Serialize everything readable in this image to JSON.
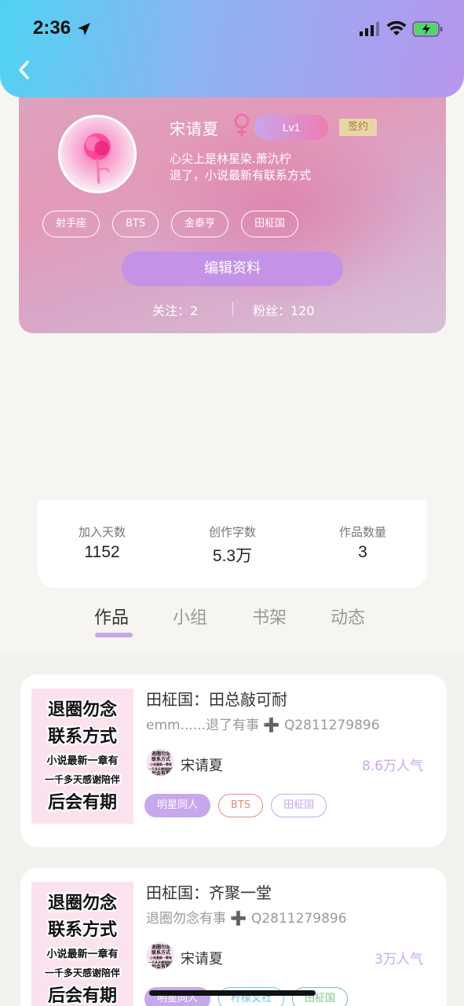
{
  "status_bar": {
    "time": "2:36"
  },
  "profile": {
    "username": "宋请夏",
    "level": "Lv1",
    "sign_badge": "签约",
    "bio_line1": "心尖上是林星染.萧氿柠",
    "bio_line2": "退了，小说最新有联系方式",
    "tags": [
      "射手座",
      "BTS",
      "金泰亨",
      "田柾国"
    ],
    "edit_button": "编辑资料",
    "following": "关注：2",
    "fans": "粉丝：120"
  },
  "stats": [
    {
      "label": "加入天数",
      "value": "1152"
    },
    {
      "label": "创作字数",
      "value": "5.3万"
    },
    {
      "label": "作品数量",
      "value": "3"
    }
  ],
  "tabs": [
    "作品",
    "小组",
    "书架",
    "动态"
  ],
  "works": [
    {
      "title": "田柾国：田总敲可耐",
      "desc": "emm......退了有事 ➕ Q2811279896",
      "author": "宋请夏",
      "popularity": "8.6万人气",
      "tags": [
        {
          "label": "明星同人",
          "color": "#c7a8ec",
          "filled": true
        },
        {
          "label": "BTS",
          "color": "#e58c86",
          "filled": false
        },
        {
          "label": "田柾国",
          "color": "#c7a8ec",
          "filled": false
        }
      ]
    },
    {
      "title": "田柾国：齐聚一堂",
      "desc": "退圈勿念有事 ➕ Q2811279896",
      "author": "宋请夏",
      "popularity": "3万人气",
      "tags": [
        {
          "label": "明星同人",
          "color": "#c7a8ec",
          "filled": true
        },
        {
          "label": "柠檬文社",
          "color": "#6cc7d9",
          "filled": false
        },
        {
          "label": "田柾国",
          "color": "#7cc48a",
          "filled": false
        }
      ]
    }
  ],
  "cover_text": [
    "退圈勿念",
    "联系方式",
    "小说最新一章有",
    "一千多天感谢陪伴",
    "后会有期"
  ],
  "colors": {
    "accent": "#c7a8ec",
    "header_start": "#4fd3f2",
    "header_end": "#b696ec"
  }
}
